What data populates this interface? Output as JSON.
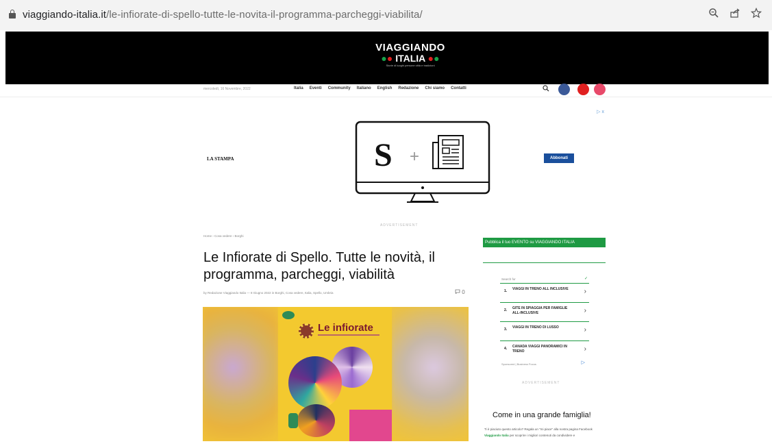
{
  "browser": {
    "url_domain": "viaggiando-italia.it",
    "url_path": "/le-infiorate-di-spello-tutte-le-novita-il-programma-parcheggi-viabilita/",
    "icons": [
      "lock-icon",
      "zoom-icon",
      "share-icon",
      "star-icon"
    ]
  },
  "header": {
    "logo_line1": "VIAGGIANDO",
    "logo_line2": "ITALIA",
    "logo_tagline": "Storie di luoghi persone città e tradizioni"
  },
  "nav": {
    "date": "mercoledì, 16 Novembre, 2022",
    "items": [
      "Italia",
      "Eventi",
      "Community",
      "Italiano",
      "English",
      "Redazione",
      "Chi siamo",
      "Contatti"
    ],
    "social_colors": {
      "facebook": "#3b5998",
      "youtube": "#e02020",
      "instagram": "#e84a6a"
    }
  },
  "ad": {
    "brand": "LA STAMPA",
    "button": "Abbonati",
    "label": "ADVERTISEMENT",
    "close": "▷ x"
  },
  "article": {
    "breadcrumb": "Home › Cosa vedere › Borghi",
    "title": "Le Infiorate di Spello. Tutte le novità, il programma, parcheggi, viabilità",
    "meta": "by Redazione Viaggiando Italia — 8 Giugno 2022 in Borghi, Cosa vedere, Italia, Spello, Umbria",
    "comments": "0",
    "poster_title": "Le infiorate"
  },
  "sidebar": {
    "banner": "Pubblica il tuo EVENTO su VIAGGIANDO ITALIA",
    "search_for": "Search for",
    "results": [
      {
        "num": "1.",
        "text": "VIAGGI IN TRENO ALL INCLUSIVE"
      },
      {
        "num": "2.",
        "text": "GITE IN SPIAGGIA PER FAMIGLIE ALL-INCLUSIVE"
      },
      {
        "num": "3.",
        "text": "VIAGGI IN TRENO DI LUSSO"
      },
      {
        "num": "4.",
        "text": "CANADA VIAGGI PANORAMICI IN TRENO"
      }
    ],
    "sponsor": "Sponsored | Business Focus",
    "ad_label": "ADVERTISEMENT",
    "heading": "Come in una grande famiglia!",
    "text_before": "Ti è piaciuto questo articolo? Regala un \"mi piace\" alla nostra pagina Facebook",
    "text_link": "Viaggiando Italia",
    "text_after": "per scoprire i migliori contenuti da condividere e"
  },
  "colors": {
    "accent_green": "#1e9a43",
    "header_bg": "#000000"
  }
}
